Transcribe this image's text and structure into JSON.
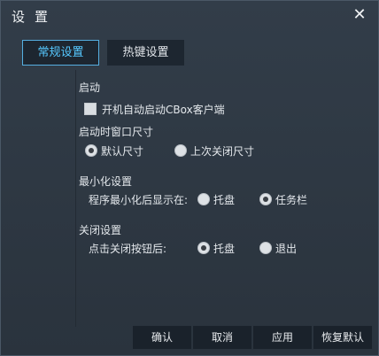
{
  "window": {
    "title": "设置",
    "close_glyph": "✕"
  },
  "tabs": [
    {
      "label": "常规设置",
      "active": true
    },
    {
      "label": "热键设置",
      "active": false
    }
  ],
  "startup": {
    "heading": "启动",
    "autostart_label": "开机自动启动CBox客户端",
    "autostart_checked": false
  },
  "window_size": {
    "heading": "启动时窗口尺寸",
    "options": [
      {
        "label": "默认尺寸",
        "selected": true
      },
      {
        "label": "上次关闭尺寸",
        "selected": false
      }
    ]
  },
  "minimize": {
    "heading": "最小化设置",
    "prompt": "程序最小化后显示在:",
    "options": [
      {
        "label": "托盘",
        "selected": false
      },
      {
        "label": "任务栏",
        "selected": true
      }
    ]
  },
  "close": {
    "heading": "关闭设置",
    "prompt": "点击关闭按钮后:",
    "options": [
      {
        "label": "托盘",
        "selected": true
      },
      {
        "label": "退出",
        "selected": false
      }
    ]
  },
  "buttons": {
    "ok": "确认",
    "cancel": "取消",
    "apply": "应用",
    "restore": "恢复默认"
  },
  "colors": {
    "accent": "#56c8ff",
    "background": "#2c3540",
    "button_bg": "#1a222b"
  }
}
